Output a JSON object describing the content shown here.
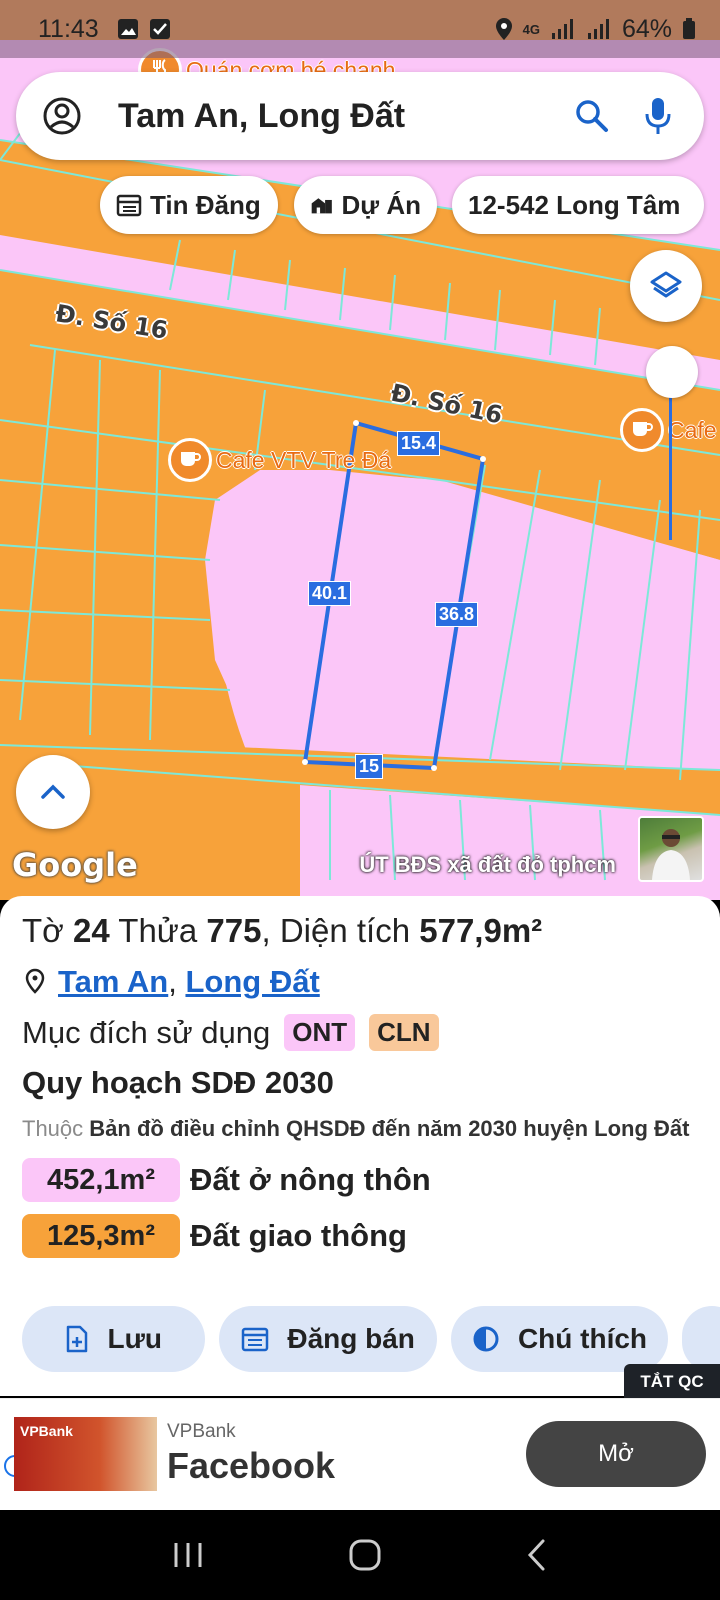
{
  "status_bar": {
    "time": "11:43",
    "network": "4G",
    "battery": "64%"
  },
  "search": {
    "query": "Tam An, Long Đất",
    "account_icon": "account-circle-icon",
    "search_icon": "search-icon",
    "mic_icon": "mic-icon"
  },
  "chips": [
    {
      "label": "Tin Đăng",
      "icon": "calendar-list-icon"
    },
    {
      "label": "Dự Án",
      "icon": "buildings-icon"
    },
    {
      "label": "12-542 Long Tâm"
    }
  ],
  "map": {
    "road_labels": [
      "Đ. Số 16",
      "Đ. Số 16"
    ],
    "poi": [
      {
        "name": "Cafe VTV Tre Đá",
        "icon": "cafe-icon"
      },
      {
        "name": "Cafe",
        "icon": "cafe-icon"
      },
      {
        "name": "Quán cơm bé chanh",
        "icon": "restaurant-icon"
      }
    ],
    "dimensions": [
      "15.4",
      "40.1",
      "36.8",
      "15"
    ],
    "logo": "Google",
    "author": "ÚT BĐS xã đất đỏ tphcm"
  },
  "parcel": {
    "sheet_label": "Tờ",
    "sheet_no": "24",
    "lot_label": "Thửa",
    "lot_no": "775",
    "area_label": "Diện tích",
    "area": "577,9m²",
    "location_a": "Tam An",
    "location_b": "Long Đất",
    "purpose_label": "Mục đích sử dụng",
    "purpose_tags": [
      "ONT",
      "CLN"
    ],
    "plan_title": "Quy hoạch SDĐ 2030",
    "plan_belongs": "Thuộc",
    "plan_desc": "Bản đồ điều chỉnh QHSDĐ đến năm 2030 huyện Long Đất",
    "areas": [
      {
        "value": "452,1m²",
        "label": "Đất ở nông thôn",
        "color": "#fbc6f8"
      },
      {
        "value": "125,3m²",
        "label": "Đất giao thông",
        "color": "#f7a23a"
      }
    ]
  },
  "actions": [
    "Lưu",
    "Đăng bán",
    "Chú thích"
  ],
  "ad": {
    "off_label": "TẮT QC",
    "brand": "VPBank",
    "title": "Facebook",
    "cta": "Mở",
    "img_text": "VPBank"
  },
  "colors": {
    "residential": "#fbc6f8",
    "road": "#f7a23a",
    "parcel_line": "#2a6de0",
    "boundary": "#7de8d8"
  }
}
